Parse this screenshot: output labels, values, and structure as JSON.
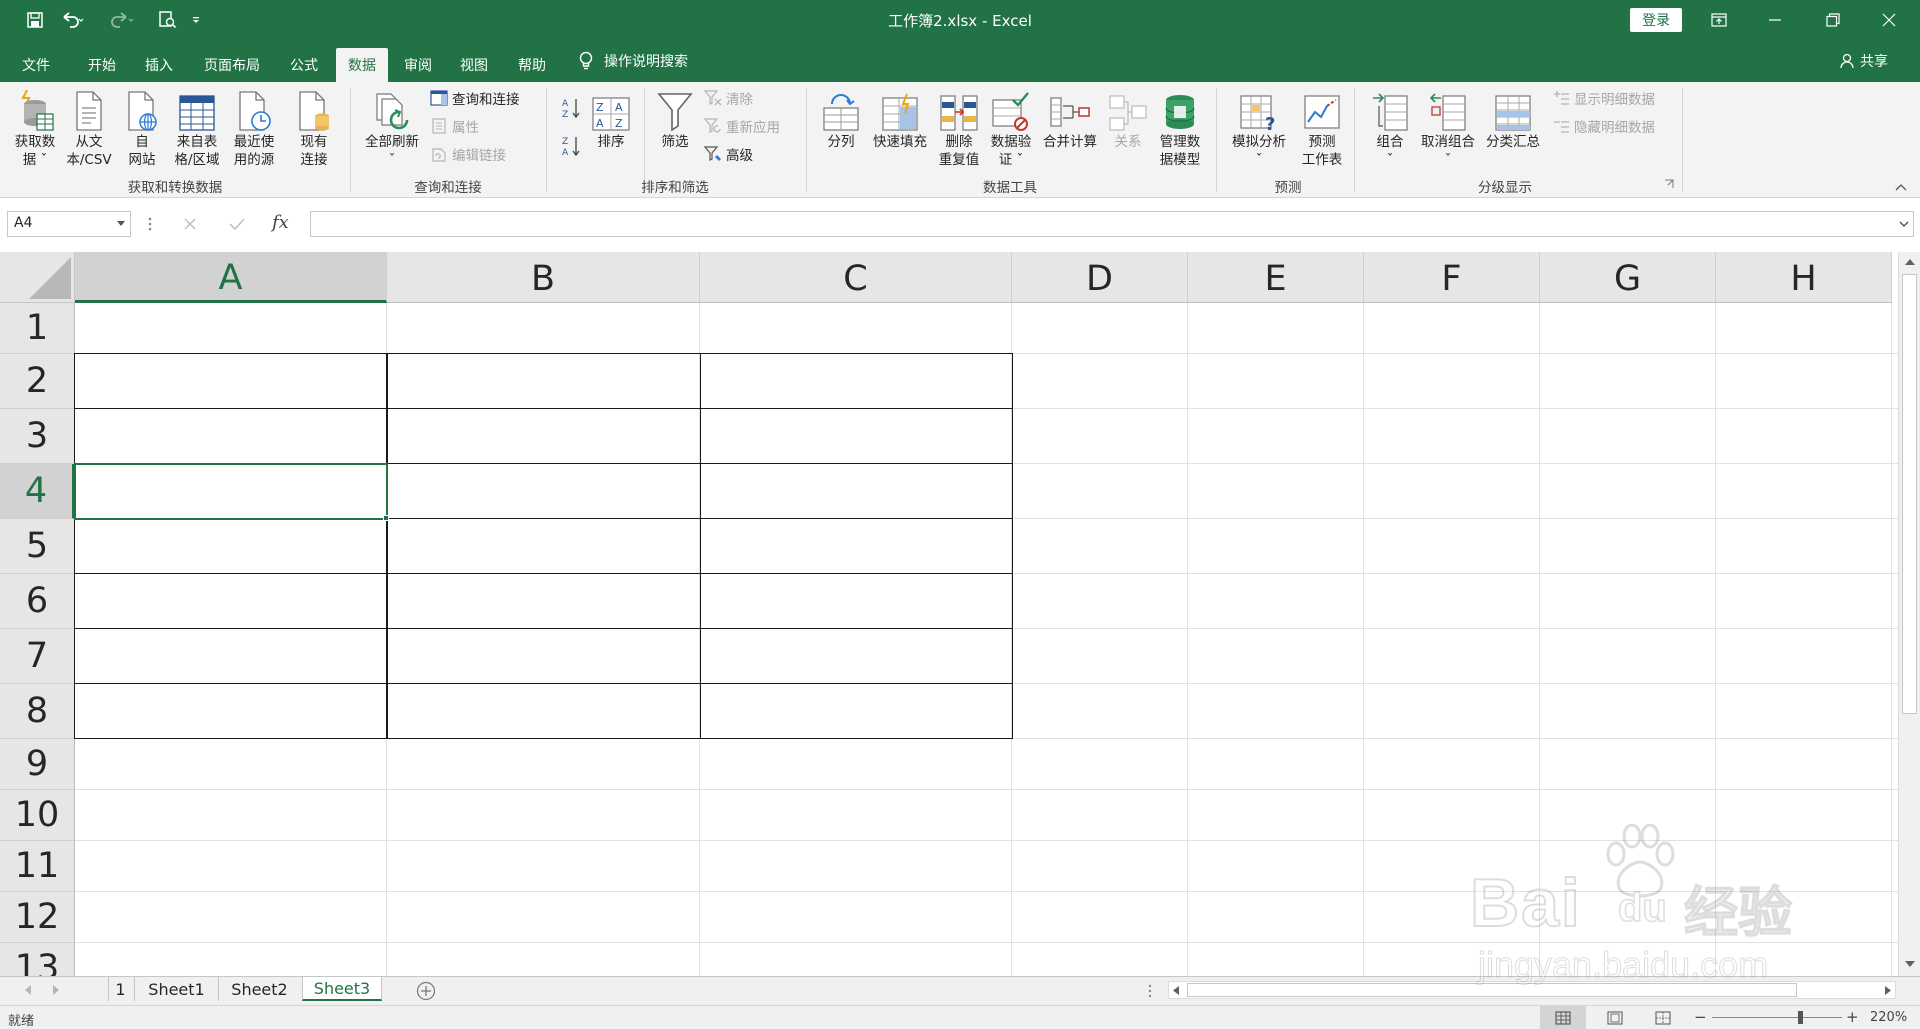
{
  "window": {
    "title": "工作簿2.xlsx  -  Excel",
    "login": "登录"
  },
  "tabs": [
    "文件",
    "开始",
    "插入",
    "页面布局",
    "公式",
    "数据",
    "审阅",
    "视图",
    "帮助"
  ],
  "active_tab": "数据",
  "tell_me": "操作说明搜索",
  "share": "共享",
  "ribbon": {
    "get_data": "获取数\n据 ˇ",
    "from_text": "从文\n本/CSV",
    "from_web": "自\n网站",
    "from_table": "来自表\n格/区域",
    "recent_sources": "最近使\n用的源",
    "existing_conn": "现有\n连接",
    "group_get_transform": "获取和转换数据",
    "refresh_all": "全部刷新\nˇ",
    "queries_conn": "查询和连接",
    "properties": "属性",
    "edit_links": "编辑链接",
    "group_queries": "查询和连接",
    "sort": "排序",
    "filter": "筛选",
    "clear": "清除",
    "reapply": "重新应用",
    "advanced": "高级",
    "group_sort_filter": "排序和筛选",
    "text_to_columns": "分列",
    "flash_fill": "快速填充",
    "remove_dup": "删除\n重复值",
    "data_validation": "数据验\n证 ˇ",
    "consolidate": "合并计算",
    "relationships": "关系",
    "manage_model": "管理数\n据模型",
    "group_data_tools": "数据工具",
    "what_if": "模拟分析\nˇ",
    "forecast_sheet": "预测\n工作表",
    "group_forecast": "预测",
    "group_btn": "组合\nˇ",
    "ungroup": "取消组合\nˇ",
    "subtotal": "分类汇总",
    "show_detail": "显示明细数据",
    "hide_detail": "隐藏明细数据",
    "group_outline": "分级显示"
  },
  "formula_bar": {
    "name_box": "A4",
    "fx": "fx",
    "formula": ""
  },
  "columns": [
    "A",
    "B",
    "C",
    "D",
    "E",
    "F",
    "G",
    "H"
  ],
  "rows": [
    "1",
    "2",
    "3",
    "4",
    "5",
    "6",
    "7",
    "8",
    "9",
    "10",
    "11",
    "12",
    "13"
  ],
  "selected_cell": "A4",
  "sheets": [
    "1",
    "Sheet1",
    "Sheet2",
    "Sheet3"
  ],
  "active_sheet": "Sheet3",
  "status": {
    "ready": "就绪",
    "zoom": "220%"
  },
  "watermark": {
    "line1": "Bai",
    "line2": "du",
    "line3": "经验",
    "url": "jingyan.baidu.com"
  },
  "colors": {
    "accent": "#217346",
    "ribbon_bg": "#f3f3f3",
    "header_bg": "#e6e6e6"
  }
}
